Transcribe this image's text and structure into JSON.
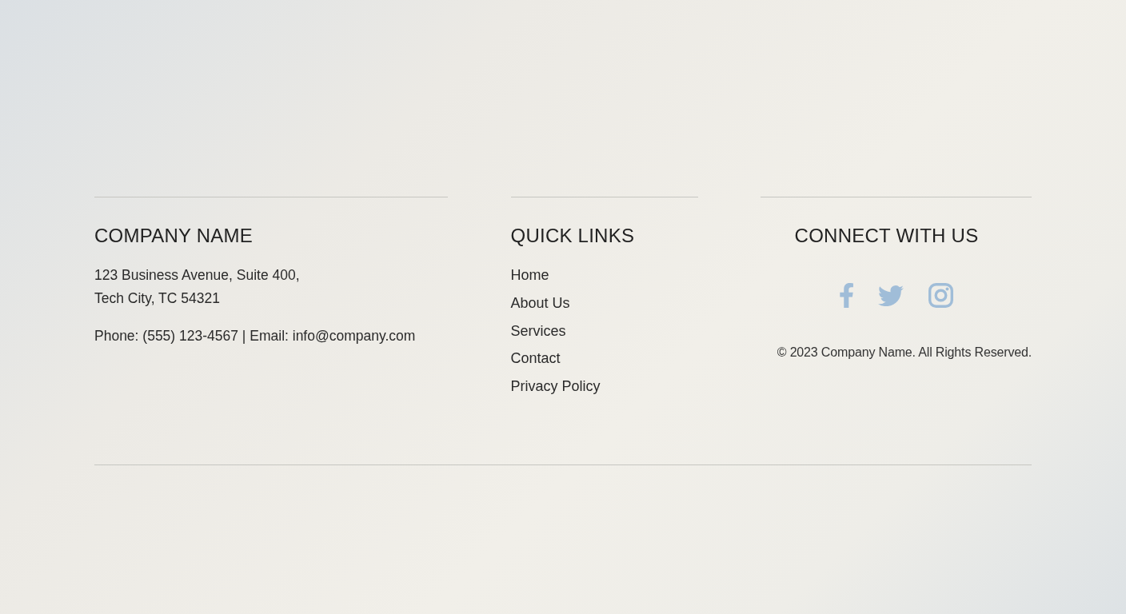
{
  "company": {
    "heading": "COMPANY NAME",
    "address_lines": [
      "123 Business Avenue, Suite 400,",
      "Tech City, TC 54321"
    ],
    "contact": "Phone: (555) 123-4567 | Email: info@company.com"
  },
  "quick_links": {
    "heading": "QUICK LINKS",
    "links": [
      "Home",
      "About Us",
      "Services",
      "Contact",
      "Privacy Policy"
    ]
  },
  "connect": {
    "heading": "CONNECT WITH US",
    "social": [
      {
        "kind": "facebook"
      },
      {
        "kind": "twitter"
      },
      {
        "kind": "instagram"
      }
    ],
    "copyright": "© 2023 Company Name. All Rights Reserved."
  }
}
